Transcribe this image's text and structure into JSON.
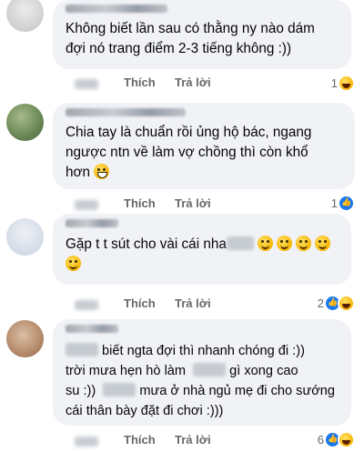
{
  "actions": {
    "like_label": "Thích",
    "reply_label": "Trả lời"
  },
  "comments": [
    {
      "text_lines": [
        "Không biết lần sau có thằng ny nào dám",
        "đợi nó trang điểm 2-3 tiếng không :))"
      ],
      "reaction_count": "1",
      "reactions": [
        "haha-icon"
      ]
    },
    {
      "text_lines": [
        "Chia tay là chuẩn rồi ủng hộ bác, ngang",
        "ngược ntn về làm vợ chồng thì còn khổ",
        "hơn"
      ],
      "reaction_count": "1",
      "reactions": [
        "like-icon"
      ]
    },
    {
      "text_lines": [
        "Gặp t t sút cho vài cái nha"
      ],
      "reaction_count": "2",
      "reactions": [
        "like-icon",
        "haha-icon"
      ]
    },
    {
      "text_lines": [
        "biết ngta đợi thì nhanh chóng đi :))",
        "trời mưa hẹn hò làm",
        "gì xong cao",
        "su :))",
        "mưa ở nhà ngủ mẹ đi cho sướng",
        "cái thân bày đặt đi chơi :)))"
      ],
      "reaction_count": "6",
      "reactions": [
        "like-icon",
        "haha-icon"
      ]
    }
  ]
}
